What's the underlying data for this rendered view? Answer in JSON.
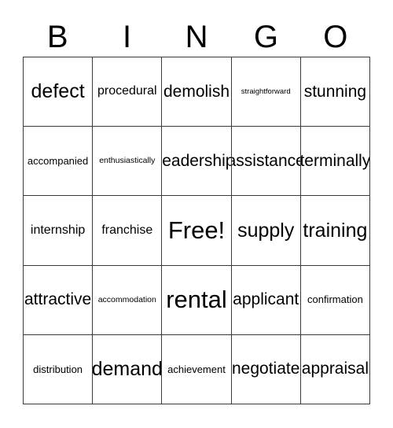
{
  "card": {
    "title": "BINGO",
    "headers": [
      "B",
      "I",
      "N",
      "G",
      "O"
    ],
    "free_space": {
      "row": 2,
      "col": 2,
      "label": "Free!"
    },
    "grid_size": "5x5",
    "rows": [
      {
        "cells": [
          {
            "label": "defect",
            "size": "lg"
          },
          {
            "label": "procedural",
            "size": "sm"
          },
          {
            "label": "demolish",
            "size": "md"
          },
          {
            "label": "straightforward",
            "size": "tiny"
          },
          {
            "label": "stunning",
            "size": "md"
          }
        ]
      },
      {
        "cells": [
          {
            "label": "accompanied",
            "size": "xs"
          },
          {
            "label": "enthusiastically",
            "size": "xxs"
          },
          {
            "label": "leadership",
            "size": "md"
          },
          {
            "label": "assistance",
            "size": "md"
          },
          {
            "label": "terminally",
            "size": "md"
          }
        ]
      },
      {
        "cells": [
          {
            "label": "internship",
            "size": "sm"
          },
          {
            "label": "franchise",
            "size": "sm"
          },
          {
            "label": "Free!",
            "size": "xl"
          },
          {
            "label": "supply",
            "size": "lg"
          },
          {
            "label": "training",
            "size": "lg"
          }
        ]
      },
      {
        "cells": [
          {
            "label": "attractive",
            "size": "md"
          },
          {
            "label": "accommodation",
            "size": "xxs"
          },
          {
            "label": "rental",
            "size": "xl"
          },
          {
            "label": "applicant",
            "size": "md"
          },
          {
            "label": "confirmation",
            "size": "xs"
          }
        ]
      },
      {
        "cells": [
          {
            "label": "distribution",
            "size": "xs"
          },
          {
            "label": "demand",
            "size": "lg"
          },
          {
            "label": "achievement",
            "size": "xs"
          },
          {
            "label": "negotiate",
            "size": "md"
          },
          {
            "label": "appraisal",
            "size": "md"
          }
        ]
      }
    ]
  },
  "style": {
    "border_color": "#3a3a3a",
    "text_color": "#000000",
    "background_color": "#ffffff"
  }
}
